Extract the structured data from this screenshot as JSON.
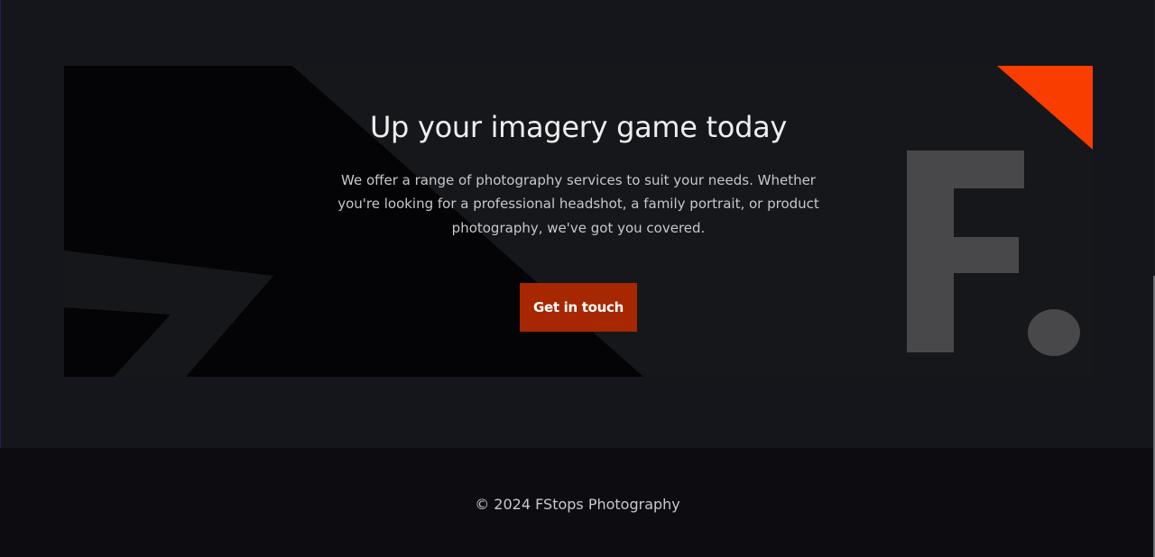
{
  "cta": {
    "title": "Up your imagery game today",
    "description": "We offer a range of photography services to suit your needs. Whether you're looking for a professional headshot, a family portrait, or product photography, we've got you covered.",
    "button_label": "Get in touch",
    "logo_letter": "F",
    "accent_color": "#f93c00",
    "button_color": "#a62701"
  },
  "footer": {
    "copyright": "© 2024 FStops Photography"
  }
}
